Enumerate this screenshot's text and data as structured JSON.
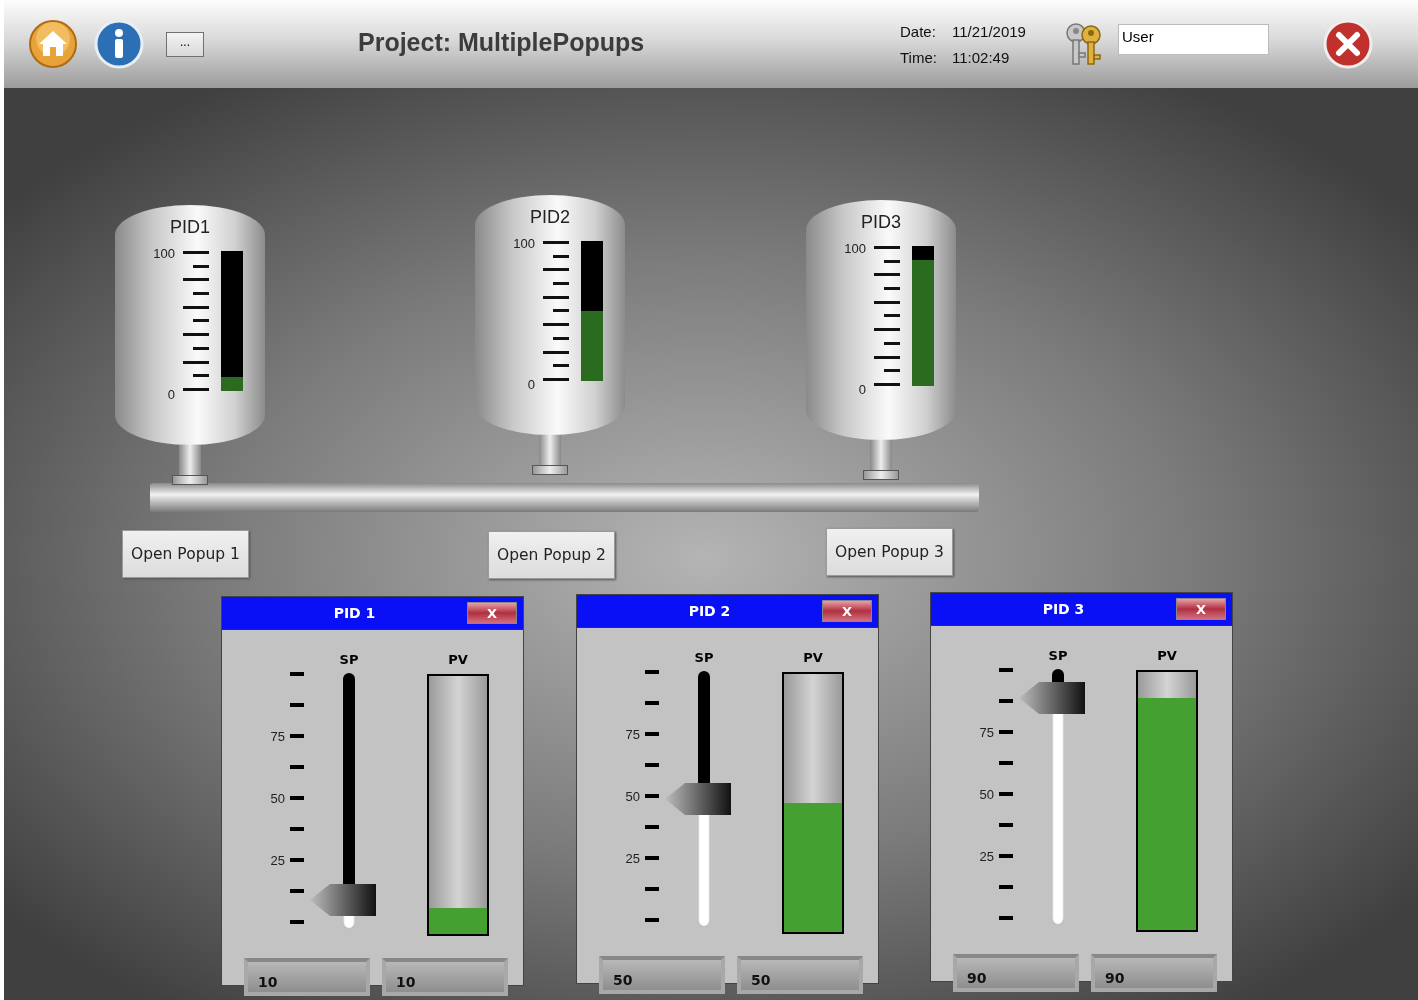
{
  "header": {
    "more_button": "...",
    "title": "Project: MultiplePopups",
    "date_label": "Date:",
    "date": "11/21/2019",
    "time_label": "Time:",
    "time": "11:02:49",
    "user": "User"
  },
  "tanks": [
    {
      "label": "PID1",
      "scale_max": "100",
      "scale_min": "0",
      "level": 0.1,
      "button": "Open Popup 1"
    },
    {
      "label": "PID2",
      "scale_max": "100",
      "scale_min": "0",
      "level": 0.5,
      "button": "Open Popup 2"
    },
    {
      "label": "PID3",
      "scale_max": "100",
      "scale_min": "0",
      "level": 0.9,
      "button": "Open Popup 3"
    }
  ],
  "popups": [
    {
      "title": "PID 1",
      "close": "X",
      "scale_labels": [
        "75",
        "50",
        "25"
      ],
      "sp": {
        "label": "SP",
        "level": 0.1,
        "value": "10"
      },
      "pv": {
        "label": "PV",
        "level": 0.1,
        "value": "10"
      }
    },
    {
      "title": "PID 2",
      "close": "X",
      "scale_labels": [
        "75",
        "50",
        "25"
      ],
      "sp": {
        "label": "SP",
        "level": 0.5,
        "value": "50"
      },
      "pv": {
        "label": "PV",
        "level": 0.5,
        "value": "50"
      }
    },
    {
      "title": "PID 3",
      "close": "X",
      "scale_labels": [
        "75",
        "50",
        "25"
      ],
      "sp": {
        "label": "SP",
        "level": 0.9,
        "value": "90"
      },
      "pv": {
        "label": "PV",
        "level": 0.9,
        "value": "90"
      }
    }
  ]
}
